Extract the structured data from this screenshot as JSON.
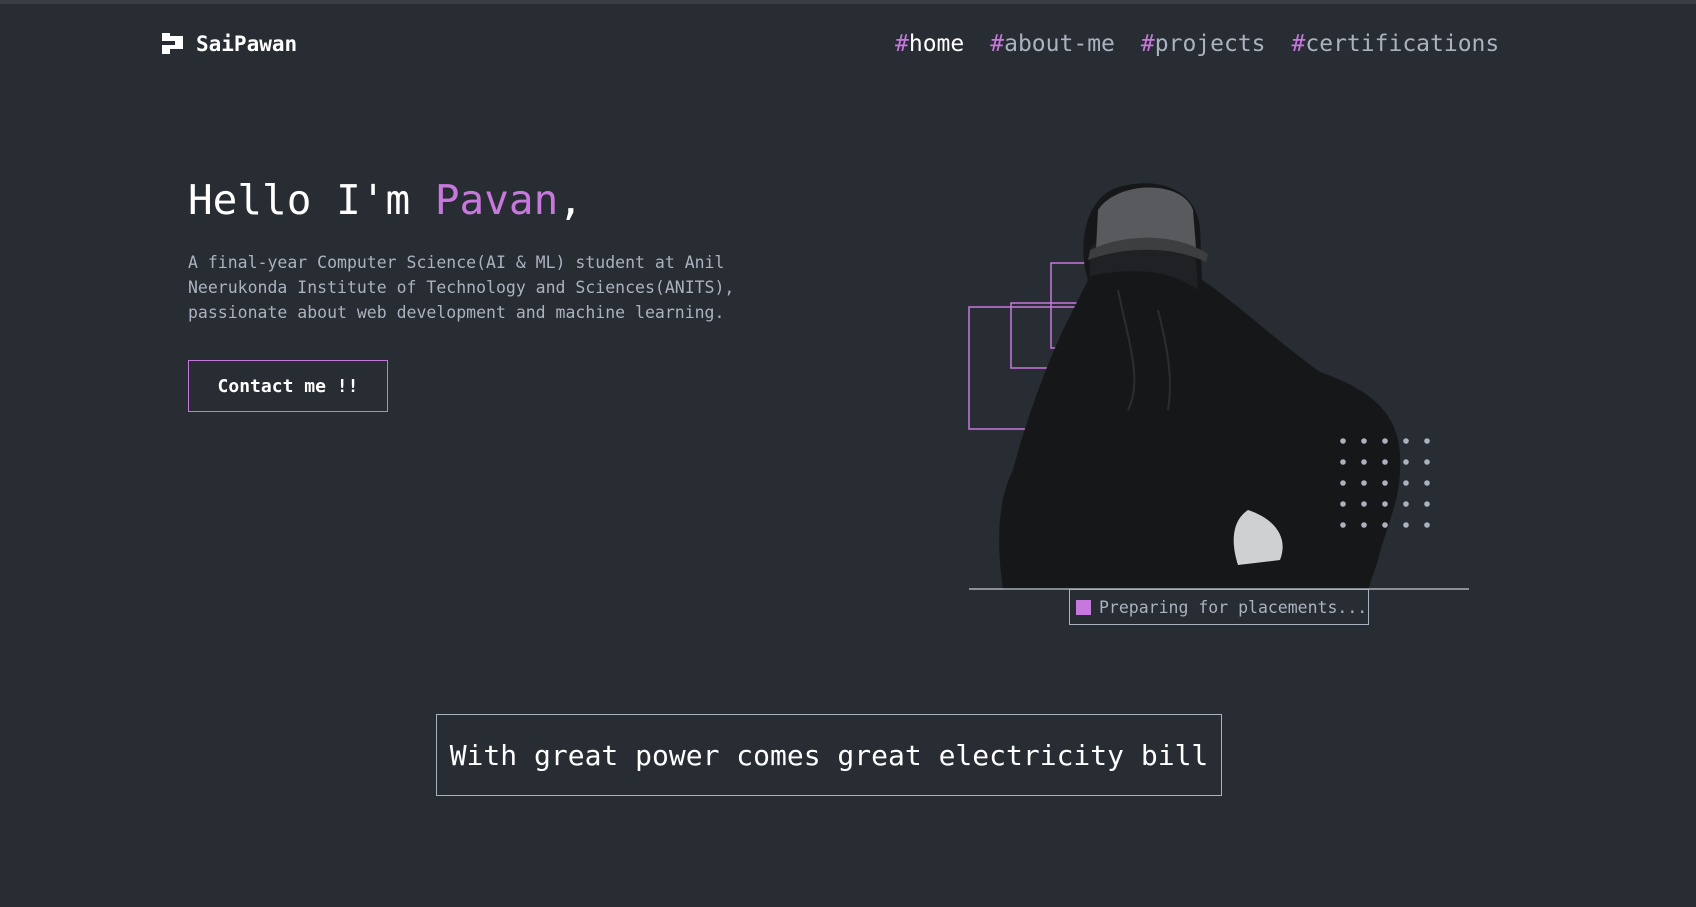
{
  "brand": {
    "name": "SaiPawan",
    "icon": "logo-icon"
  },
  "nav": {
    "items": [
      {
        "hash": "#",
        "label": "home"
      },
      {
        "hash": "#",
        "label": "about-me"
      },
      {
        "hash": "#",
        "label": "projects"
      },
      {
        "hash": "#",
        "label": "certifications"
      }
    ]
  },
  "hero": {
    "greeting": "Hello I'm ",
    "name": "Pavan",
    "punct": ",",
    "description": "A final-year Computer Science(AI & ML) student at Anil Neerukonda Institute of Technology and Sciences(ANITS), passionate about web development and machine learning.",
    "contact_label": "Contact me !!",
    "status_text": "Preparing for placements..."
  },
  "quote": {
    "text": "With great power comes great electricity bill"
  },
  "colors": {
    "background": "#282c33",
    "accent": "#c778dd",
    "muted": "#abb2bf",
    "white": "#ffffff"
  }
}
